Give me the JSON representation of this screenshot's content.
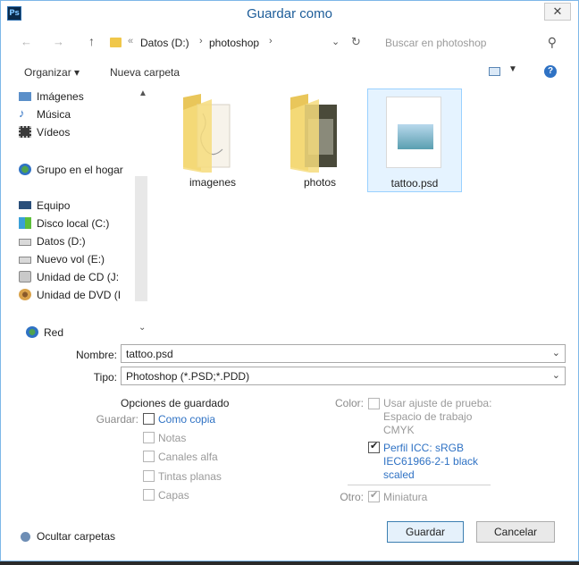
{
  "window": {
    "title": "Guardar como",
    "app_icon": "Ps",
    "close_glyph": "✕"
  },
  "navbar": {
    "back_glyph": "←",
    "forward_glyph": "→",
    "up_glyph": "↑",
    "chevron_glyph": "«",
    "path": [
      "Datos (D:)",
      "photoshop"
    ],
    "sep_glyph": "›",
    "dropdown_glyph": "⌄",
    "refresh_glyph": "↻",
    "search_placeholder": "Buscar en photoshop",
    "search_glyph": "⚲"
  },
  "toolbar": {
    "organize": "Organizar ▾",
    "new_folder": "Nueva carpeta",
    "view_dd": "▼",
    "help": "?"
  },
  "nav": {
    "libraries": [
      {
        "label": "Imágenes",
        "icon": "images-icon"
      },
      {
        "label": "Música",
        "icon": "music-icon"
      },
      {
        "label": "Vídeos",
        "icon": "videos-icon"
      }
    ],
    "homegroup": "Grupo en el hogar",
    "computer": "Equipo",
    "drives": [
      {
        "label": "Disco local (C:)",
        "icon": "disk-icon"
      },
      {
        "label": "Datos (D:)",
        "icon": "disk-icon"
      },
      {
        "label": "Nuevo vol (E:)",
        "icon": "disk-icon"
      },
      {
        "label": "Unidad de CD (J:",
        "icon": "cd-icon"
      },
      {
        "label": "Unidad de DVD (I",
        "icon": "dvd-icon"
      }
    ],
    "network": "Red",
    "collapse_up": "▲",
    "collapse_down": "⌄"
  },
  "files": [
    {
      "label": "imagenes",
      "kind": "folder"
    },
    {
      "label": "photos",
      "kind": "folder"
    },
    {
      "label": "tattoo.psd",
      "kind": "psd",
      "selected": true
    }
  ],
  "form": {
    "name_label": "Nombre:",
    "name_value": "tattoo.psd",
    "type_label": "Tipo:",
    "type_value": "Photoshop (*.PSD;*.PDD)",
    "dd_glyph": "⌄"
  },
  "options": {
    "heading": "Opciones de guardado",
    "save_label": "Guardar:",
    "as_copy": "Como copia",
    "notes": "Notas",
    "alpha": "Canales alfa",
    "spot": "Tintas planas",
    "layers": "Capas",
    "color_label": "Color:",
    "proof": "Usar ajuste de prueba:",
    "proof_line2": "Espacio de trabajo",
    "proof_line3": "CMYK",
    "icc": "Perfil ICC: sRGB",
    "icc_line2": "IEC61966-2-1 black",
    "icc_line3": "scaled",
    "other_label": "Otro:",
    "thumbnail": "Miniatura",
    "check_glyph": "✔"
  },
  "footer": {
    "hide_folders": "Ocultar carpetas",
    "save_button": "Guardar",
    "cancel_button": "Cancelar"
  }
}
